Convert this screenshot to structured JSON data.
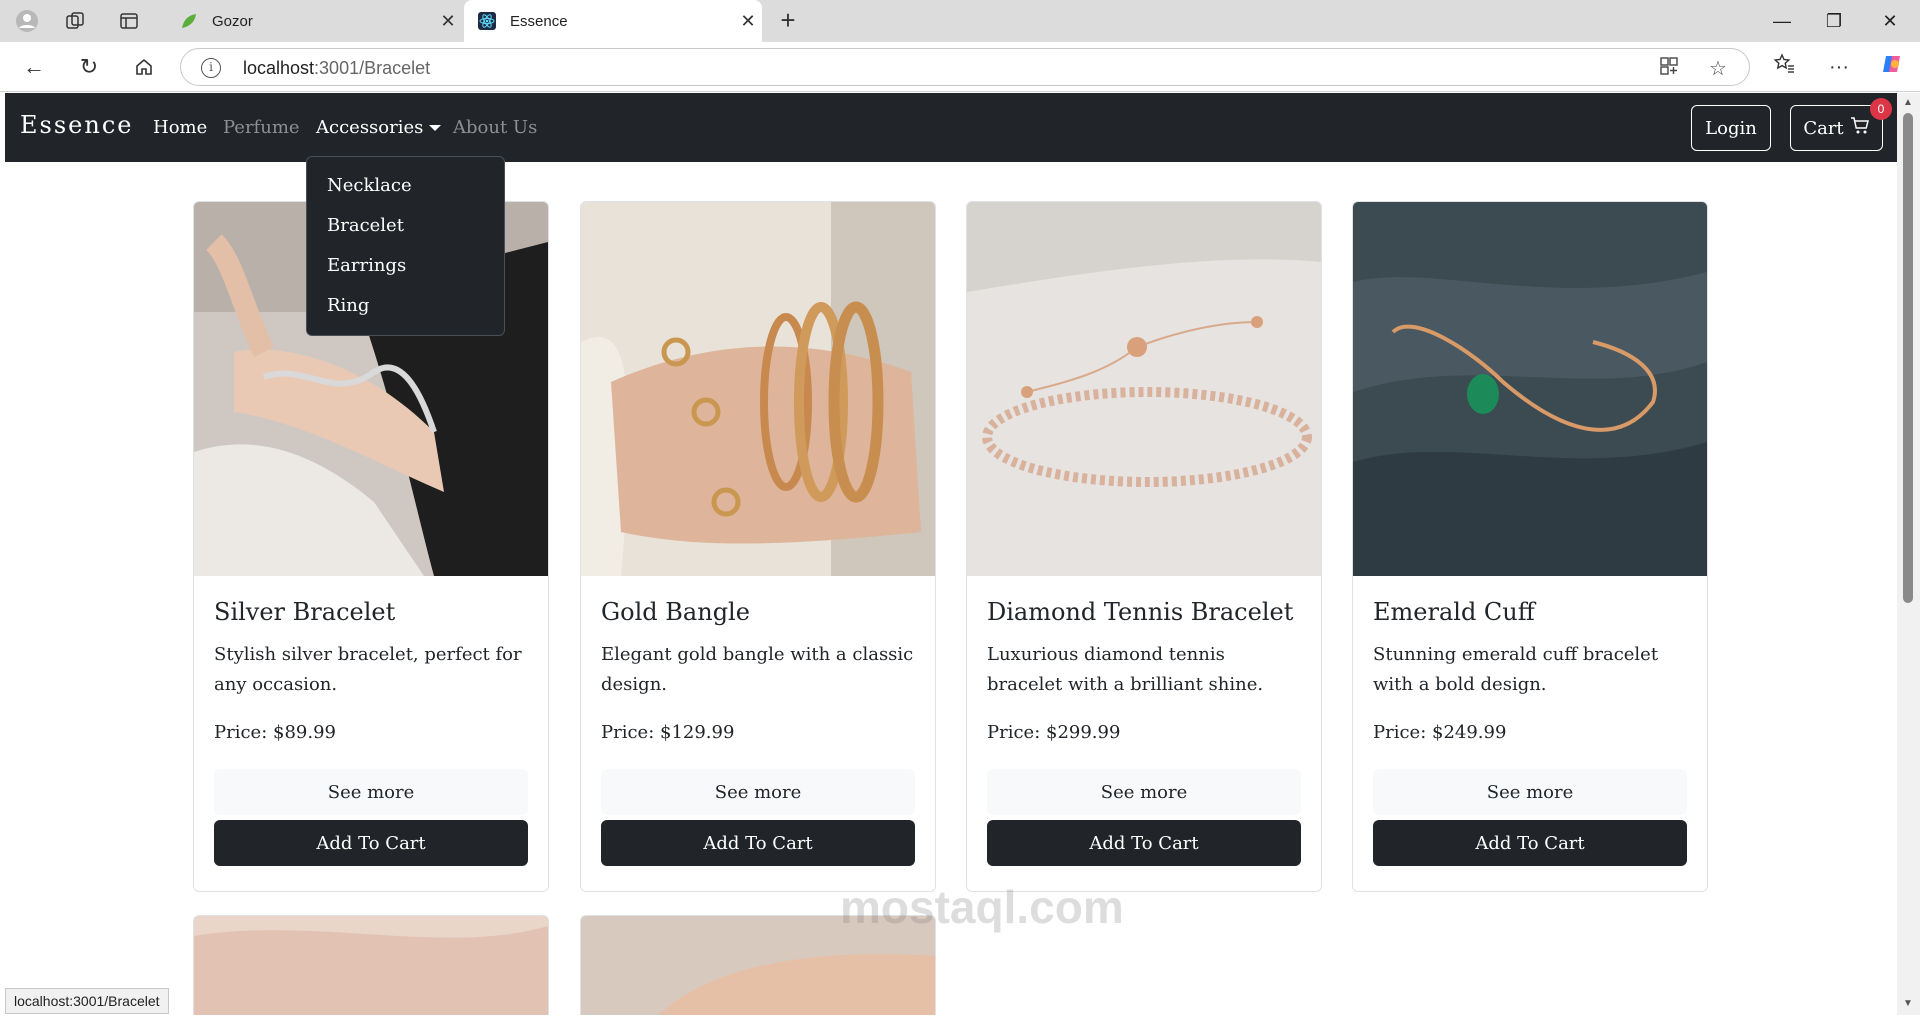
{
  "browser": {
    "tabs": [
      {
        "title": "Gozor",
        "active": false
      },
      {
        "title": "Essence",
        "active": true
      }
    ],
    "url_host": "localhost",
    "url_path": ":3001/Bracelet",
    "status_text": "localhost:3001/Bracelet"
  },
  "navbar": {
    "brand": "Essence",
    "links": {
      "home": "Home",
      "perfume": "Perfume",
      "accessories": "Accessories",
      "about": "About Us"
    },
    "login": "Login",
    "cart": "Cart",
    "cart_count": "0"
  },
  "dropdown": {
    "items": [
      "Necklace",
      "Bracelet",
      "Earrings",
      "Ring"
    ]
  },
  "products": [
    {
      "title": "Silver Bracelet",
      "desc": "Stylish silver bracelet, perfect for any occasion.",
      "price": "Price: $89.99",
      "see_more": "See more",
      "add": "Add To Cart"
    },
    {
      "title": "Gold Bangle",
      "desc": "Elegant gold bangle with a classic design.",
      "price": "Price: $129.99",
      "see_more": "See more",
      "add": "Add To Cart"
    },
    {
      "title": "Diamond Tennis Bracelet",
      "desc": "Luxurious diamond tennis bracelet with a brilliant shine.",
      "price": "Price: $299.99",
      "see_more": "See more",
      "add": "Add To Cart"
    },
    {
      "title": "Emerald Cuff",
      "desc": "Stunning emerald cuff bracelet with a bold design.",
      "price": "Price: $249.99",
      "see_more": "See more",
      "add": "Add To Cart"
    }
  ],
  "watermark": "mostaql.com"
}
